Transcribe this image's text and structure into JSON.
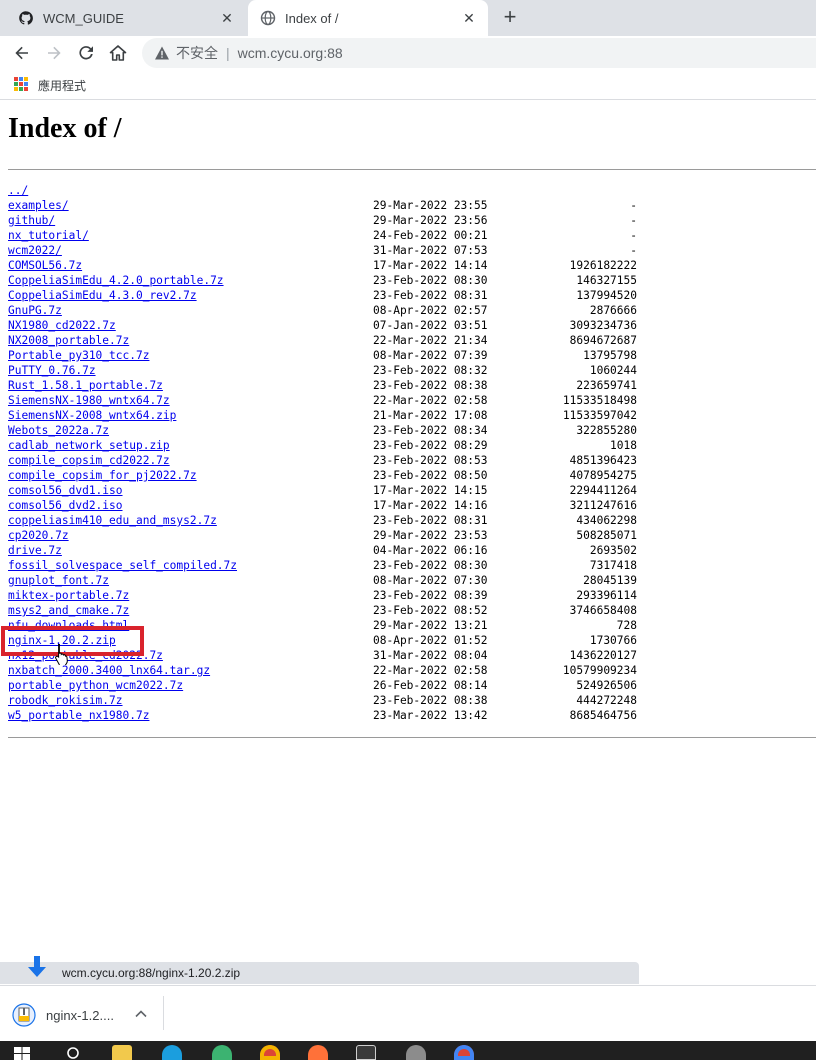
{
  "browser": {
    "tabs": [
      {
        "title": "WCM_GUIDE",
        "favicon": "github-icon",
        "active": false
      },
      {
        "title": "Index of /",
        "favicon": "globe-icon",
        "active": true
      }
    ],
    "security_label": "不安全",
    "url": "wcm.cycu.org:88",
    "bookmarks_apps_label": "應用程式"
  },
  "page": {
    "title": "Index of /",
    "parent_link": "../",
    "files": [
      {
        "name": "examples/",
        "date": "29-Mar-2022 23:55",
        "size": "-"
      },
      {
        "name": "github/",
        "date": "29-Mar-2022 23:56",
        "size": "-"
      },
      {
        "name": "nx_tutorial/",
        "date": "24-Feb-2022 00:21",
        "size": "-"
      },
      {
        "name": "wcm2022/",
        "date": "31-Mar-2022 07:53",
        "size": "-"
      },
      {
        "name": "COMSOL56.7z",
        "date": "17-Mar-2022 14:14",
        "size": "1926182222"
      },
      {
        "name": "CoppeliaSimEdu_4.2.0_portable.7z",
        "date": "23-Feb-2022 08:30",
        "size": "146327155"
      },
      {
        "name": "CoppeliaSimEdu_4.3.0_rev2.7z",
        "date": "23-Feb-2022 08:31",
        "size": "137994520"
      },
      {
        "name": "GnuPG.7z",
        "date": "08-Apr-2022 02:57",
        "size": "2876666"
      },
      {
        "name": "NX1980_cd2022.7z",
        "date": "07-Jan-2022 03:51",
        "size": "3093234736"
      },
      {
        "name": "NX2008_portable.7z",
        "date": "22-Mar-2022 21:34",
        "size": "8694672687"
      },
      {
        "name": "Portable_py310_tcc.7z",
        "date": "08-Mar-2022 07:39",
        "size": "13795798"
      },
      {
        "name": "PuTTY_0.76.7z",
        "date": "23-Feb-2022 08:32",
        "size": "1060244"
      },
      {
        "name": "Rust_1.58.1_portable.7z",
        "date": "23-Feb-2022 08:38",
        "size": "223659741"
      },
      {
        "name": "SiemensNX-1980_wntx64.7z",
        "date": "22-Mar-2022 02:58",
        "size": "11533518498"
      },
      {
        "name": "SiemensNX-2008_wntx64.zip",
        "date": "21-Mar-2022 17:08",
        "size": "11533597042"
      },
      {
        "name": "Webots_2022a.7z",
        "date": "23-Feb-2022 08:34",
        "size": "322855280"
      },
      {
        "name": "cadlab_network_setup.zip",
        "date": "23-Feb-2022 08:29",
        "size": "1018"
      },
      {
        "name": "compile_copsim_cd2022.7z",
        "date": "23-Feb-2022 08:53",
        "size": "4851396423"
      },
      {
        "name": "compile_copsim_for_pj2022.7z",
        "date": "23-Feb-2022 08:50",
        "size": "4078954275"
      },
      {
        "name": "comsol56_dvd1.iso",
        "date": "17-Mar-2022 14:15",
        "size": "2294411264"
      },
      {
        "name": "comsol56_dvd2.iso",
        "date": "17-Mar-2022 14:16",
        "size": "3211247616"
      },
      {
        "name": "coppeliasim410_edu_and_msys2.7z",
        "date": "23-Feb-2022 08:31",
        "size": "434062298"
      },
      {
        "name": "cp2020.7z",
        "date": "29-Mar-2022 23:53",
        "size": "508285071"
      },
      {
        "name": "drive.7z",
        "date": "04-Mar-2022 06:16",
        "size": "2693502"
      },
      {
        "name": "fossil_solvespace_self_compiled.7z",
        "date": "23-Feb-2022 08:30",
        "size": "7317418"
      },
      {
        "name": "gnuplot_font.7z",
        "date": "08-Mar-2022 07:30",
        "size": "28045139"
      },
      {
        "name": "miktex-portable.7z",
        "date": "23-Feb-2022 08:39",
        "size": "293396114"
      },
      {
        "name": "msys2_and_cmake.7z",
        "date": "23-Feb-2022 08:52",
        "size": "3746658408"
      },
      {
        "name": "nfu_downloads.html",
        "date": "29-Mar-2022 13:21",
        "size": "728"
      },
      {
        "name": "nginx-1.20.2.zip",
        "date": "08-Apr-2022 01:52",
        "size": "1730766"
      },
      {
        "name": "nx12_portable_cd2022.7z",
        "date": "31-Mar-2022 08:04",
        "size": "1436220127"
      },
      {
        "name": "nxbatch_2000.3400_lnx64.tar.gz",
        "date": "22-Mar-2022 02:58",
        "size": "10579909234"
      },
      {
        "name": "portable_python_wcm2022.7z",
        "date": "26-Feb-2022 08:14",
        "size": "524926506"
      },
      {
        "name": "robodk_rokisim.7z",
        "date": "23-Feb-2022 08:38",
        "size": "444272248"
      },
      {
        "name": "w5_portable_nx1980.7z",
        "date": "23-Mar-2022 13:42",
        "size": "8685464756"
      }
    ],
    "highlighted_file": "nginx-1.20.2.zip",
    "highlight_color": "#d9232c",
    "link_color": "#0000ee"
  },
  "status_bar": {
    "link_url": "wcm.cycu.org:88/nginx-1.20.2.zip"
  },
  "download_shelf": {
    "items": [
      {
        "filename": "nginx-1.2....",
        "icon": "zip-archive-icon"
      }
    ]
  },
  "taskbar": {
    "icons": [
      "windows-start-icon",
      "search-icon",
      "file-explorer-icon",
      "edge-icon",
      "ie-icon",
      "chrome-icon",
      "firefox-icon",
      "terminal-icon",
      "app-icon",
      "chrome-alt-icon"
    ]
  }
}
